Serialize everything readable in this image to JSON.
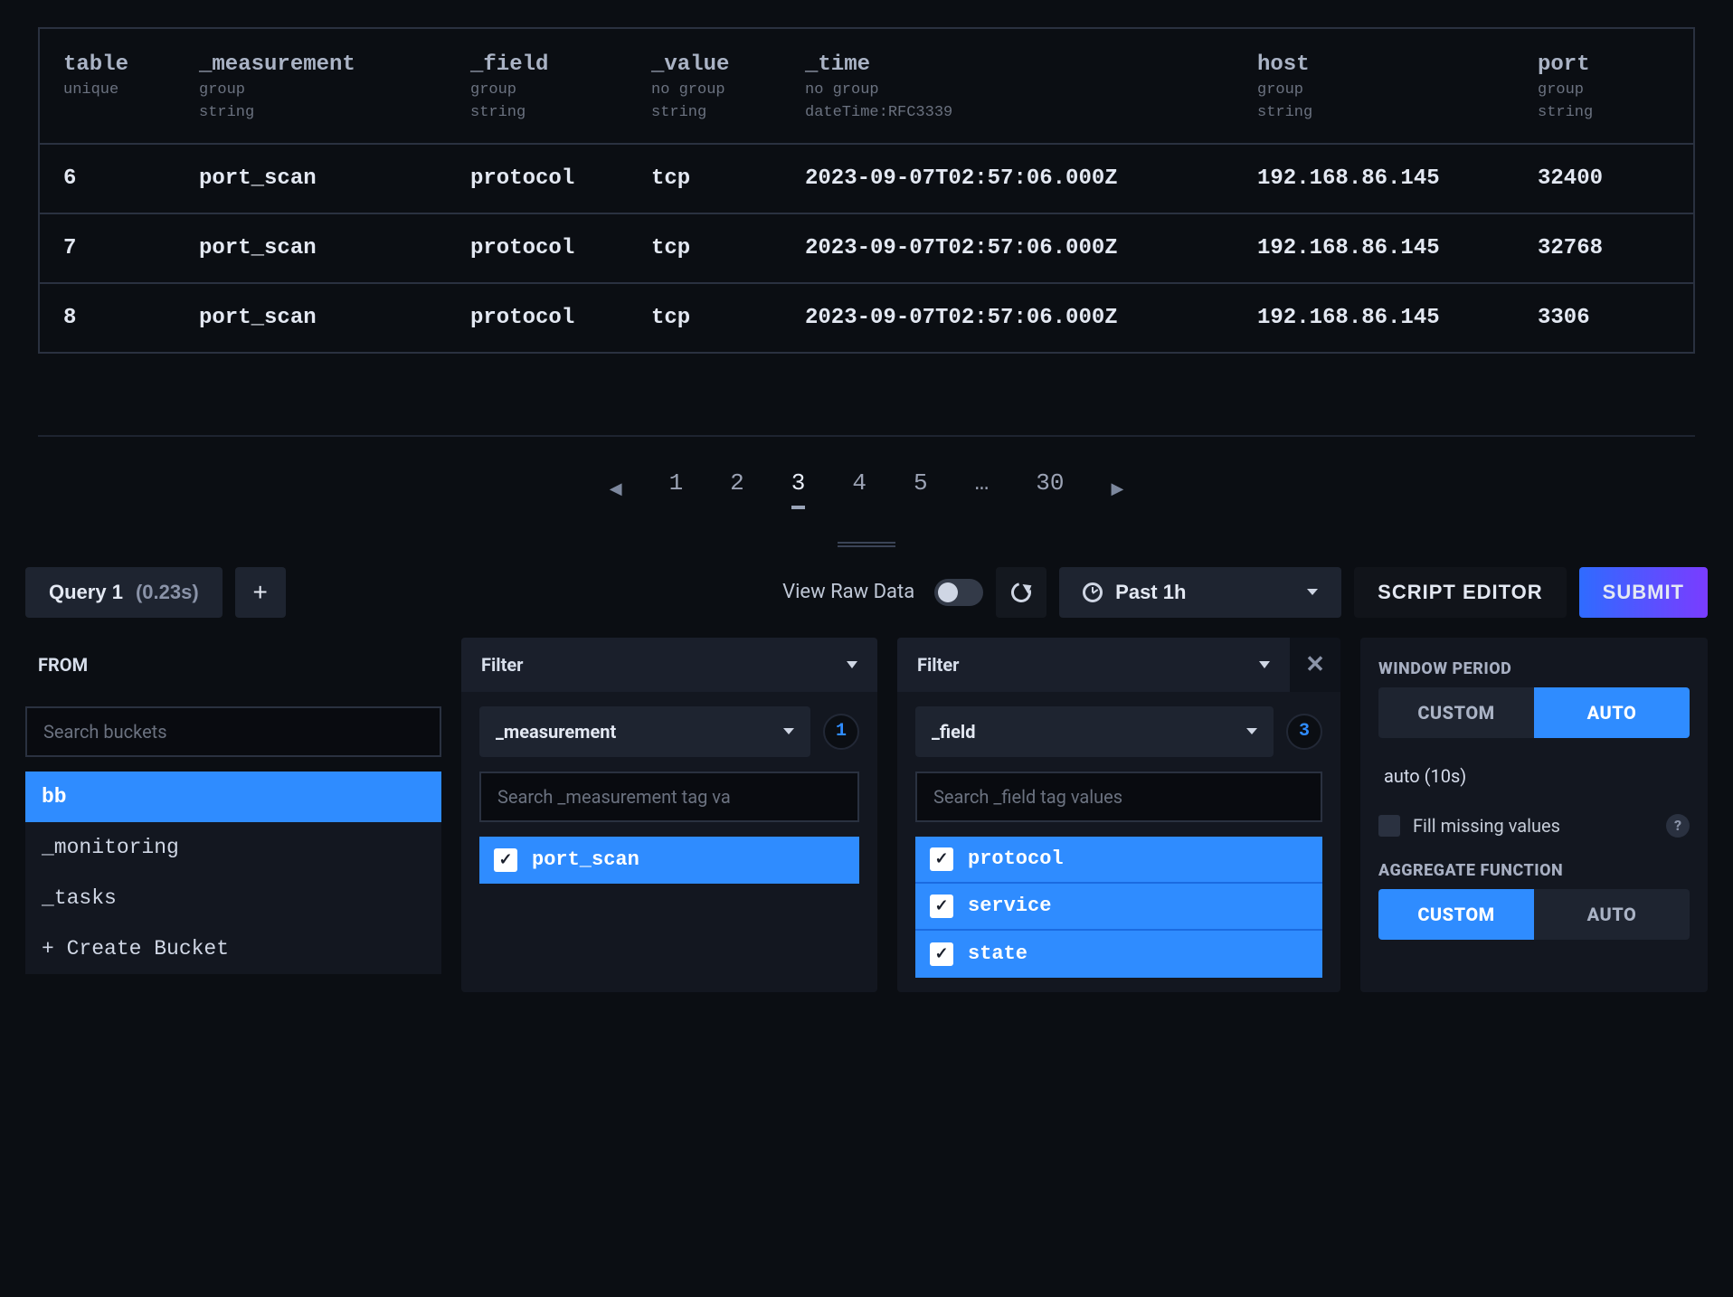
{
  "table": {
    "columns": [
      {
        "name": "table",
        "sub1": "unique",
        "sub2": ""
      },
      {
        "name": "_measurement",
        "sub1": "group",
        "sub2": "string"
      },
      {
        "name": "_field",
        "sub1": "group",
        "sub2": "string"
      },
      {
        "name": "_value",
        "sub1": "no group",
        "sub2": "string"
      },
      {
        "name": "_time",
        "sub1": "no group",
        "sub2": "dateTime:RFC3339"
      },
      {
        "name": "host",
        "sub1": "group",
        "sub2": "string"
      },
      {
        "name": "port",
        "sub1": "group",
        "sub2": "string"
      }
    ],
    "rows": [
      [
        "6",
        "port_scan",
        "protocol",
        "tcp",
        "2023-09-07T02:57:06.000Z",
        "192.168.86.145",
        "32400"
      ],
      [
        "7",
        "port_scan",
        "protocol",
        "tcp",
        "2023-09-07T02:57:06.000Z",
        "192.168.86.145",
        "32768"
      ],
      [
        "8",
        "port_scan",
        "protocol",
        "tcp",
        "2023-09-07T02:57:06.000Z",
        "192.168.86.145",
        "3306"
      ]
    ]
  },
  "pager": {
    "pages": [
      "1",
      "2",
      "3",
      "4",
      "5",
      "…",
      "30"
    ],
    "active_index": 2
  },
  "toolbar": {
    "query_tab": "Query 1",
    "query_time": "(0.23s)",
    "add_label": "+",
    "raw_label": "View Raw Data",
    "raw_on": false,
    "time_range": "Past 1h",
    "script_editor": "SCRIPT EDITOR",
    "submit": "SUBMIT"
  },
  "from": {
    "title": "FROM",
    "search_placeholder": "Search buckets",
    "items": [
      {
        "label": "bb",
        "selected": true
      },
      {
        "label": "_monitoring",
        "selected": false
      },
      {
        "label": "_tasks",
        "selected": false
      },
      {
        "label": "+ Create Bucket",
        "selected": false
      }
    ]
  },
  "filter1": {
    "header": "Filter",
    "key": "_measurement",
    "count": "1",
    "search_placeholder": "Search _measurement tag va",
    "values": [
      {
        "label": "port_scan",
        "checked": true
      }
    ]
  },
  "filter2": {
    "header": "Filter",
    "key": "_field",
    "count": "3",
    "search_placeholder": "Search _field tag values",
    "values": [
      {
        "label": "protocol",
        "checked": true
      },
      {
        "label": "service",
        "checked": true
      },
      {
        "label": "state",
        "checked": true
      }
    ]
  },
  "right": {
    "window_label": "WINDOW PERIOD",
    "wp_custom": "CUSTOM",
    "wp_auto": "AUTO",
    "wp_active": "auto",
    "auto_text": "auto (10s)",
    "fill_label": "Fill missing values",
    "agg_label": "AGGREGATE FUNCTION",
    "agg_custom": "CUSTOM",
    "agg_auto": "AUTO",
    "agg_active": "custom"
  }
}
